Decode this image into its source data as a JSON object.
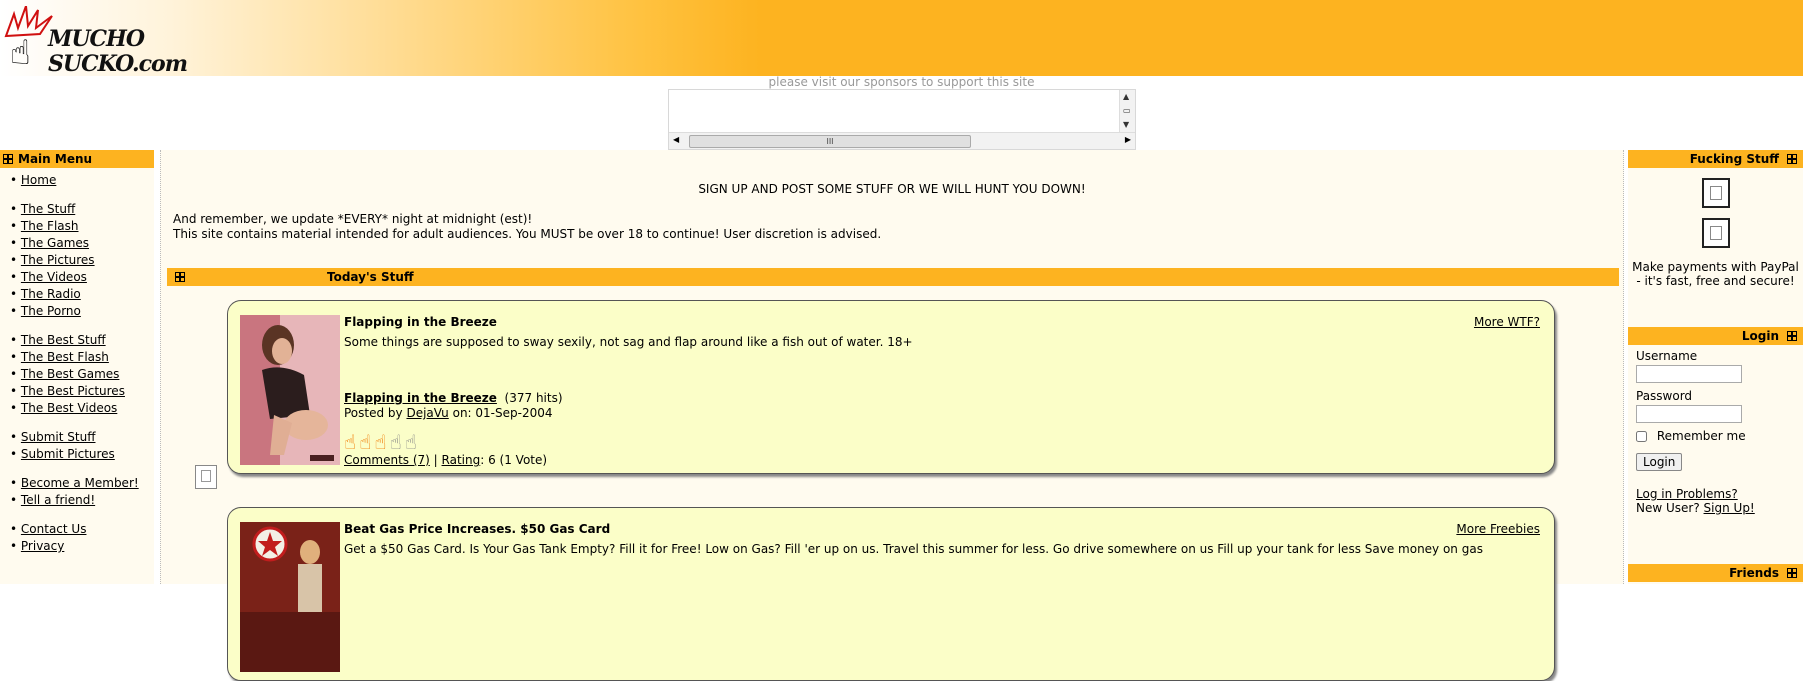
{
  "header": {
    "logo_line1": "MUCHO",
    "logo_line2": "SUCKO.com",
    "sponsor_text": "please visit our sponsors to support this site"
  },
  "colors": {
    "accent": "#fdb320",
    "panel_bg": "#fffbef",
    "card_bg": "#fbfec8",
    "rating_on": "#f07800"
  },
  "main_menu": {
    "title": "Main Menu",
    "items": [
      "Home",
      "The Stuff",
      "The Flash",
      "The Games",
      "The Pictures",
      "The Videos",
      "The Radio",
      "The Porno",
      "The Best Stuff",
      "The Best Flash",
      "The Best Games",
      "The Best Pictures",
      "The Best Videos",
      "Submit Stuff",
      "Submit Pictures",
      "Become a Member!",
      "Tell a friend!",
      "Contact Us",
      "Privacy"
    ]
  },
  "center": {
    "signup": "SIGN UP AND POST SOME STUFF OR WE WILL HUNT YOU DOWN!",
    "notice1": "And remember, we update *EVERY* night at midnight (est)!",
    "notice2": "This site contains material intended for adult audiences. You MUST be over 18 to continue! User discretion is advised.",
    "todays_stuff": "Today's Stuff",
    "cards": [
      {
        "title": "Flapping in the Breeze",
        "more": "More WTF?",
        "desc": "Some things are supposed to sway sexily, not sag and flap around like a fish out of water. 18+",
        "link": "Flapping in the Breeze",
        "hits": "(377 hits)",
        "posted_prefix": "Posted by",
        "author": "DejaVu",
        "posted_on": "on: 01-Sep-2004",
        "rating_value": 3,
        "rating_max": 5,
        "comments": "Comments (7)",
        "rating_label": "Rating",
        "rating_text": ": 6 (1 Vote)"
      },
      {
        "title": "Beat Gas Price Increases. $50 Gas Card",
        "more": "More Freebies",
        "desc": "Get a $50 Gas Card. Is Your Gas Tank Empty? Fill it for Free! Low on Gas? Fill 'er up on us. Travel this summer for less. Go drive somewhere on us Fill up your tank for less Save money on gas"
      }
    ]
  },
  "right": {
    "fucking_stuff_title": "Fucking Stuff",
    "paypal_text": "Make payments with PayPal - it's fast, free and secure!",
    "login_title": "Login",
    "username_label": "Username",
    "password_label": "Password",
    "remember_label": "Remember me",
    "login_button": "Login",
    "login_problems": "Log in Problems?",
    "new_user": "New User?",
    "sign_up": "Sign Up!",
    "friends_title": "Friends"
  }
}
